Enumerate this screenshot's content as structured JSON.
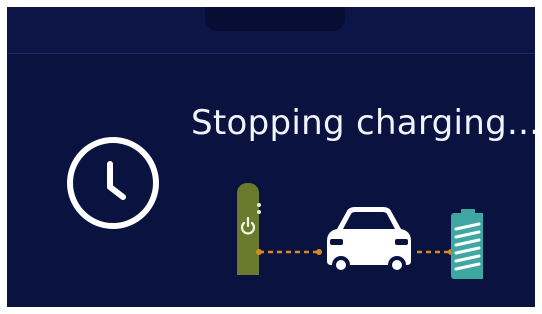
{
  "status": {
    "message": "Stopping charging..."
  },
  "icons": {
    "clock": "clock-icon",
    "charger": "charging-station-icon",
    "power": "power-icon",
    "car": "car-icon",
    "battery": "battery-icon"
  },
  "colors": {
    "background": "#0a1240",
    "text": "#f2f4fb",
    "charger": "#6b7a2c",
    "cable": "#d98a1f",
    "battery": "#3fa7a1"
  }
}
